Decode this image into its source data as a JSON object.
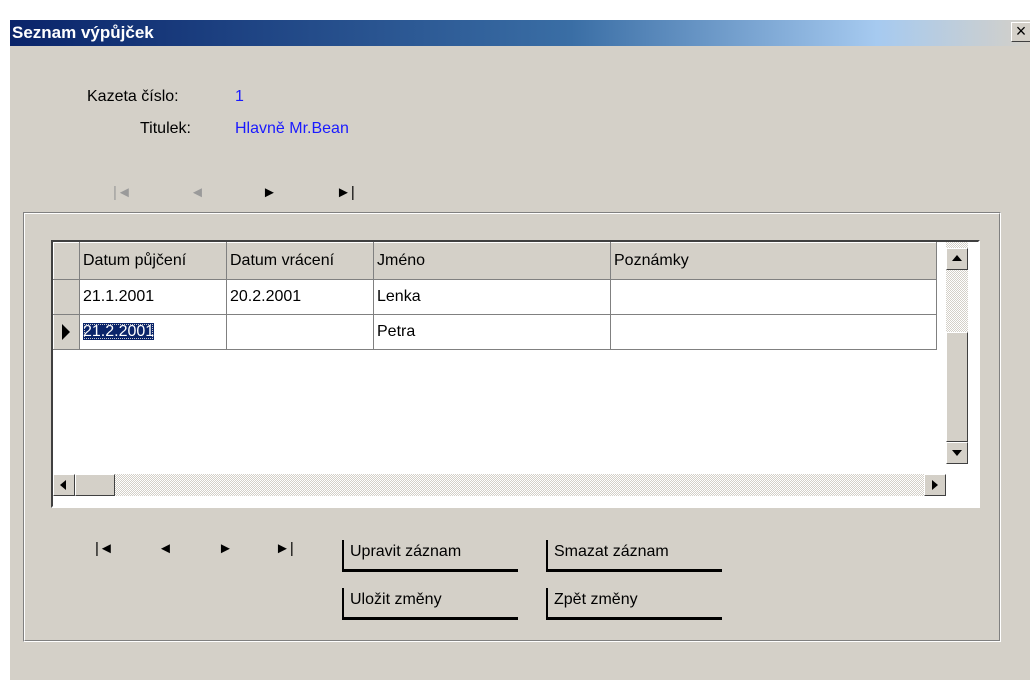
{
  "window": {
    "title": "Seznam výpůjček",
    "close_label": "×"
  },
  "header": {
    "tape_label": "Kazeta číslo:",
    "tape_value": "1",
    "title_label": "Titulek:",
    "title_value": "Hlavně Mr.Bean"
  },
  "top_nav": {
    "first": "|◄",
    "prev": "◄",
    "next": "►",
    "last": "►|"
  },
  "grid": {
    "columns": [
      "Datum půjčení",
      "Datum vrácení",
      "Jméno",
      "Poznámky"
    ],
    "rows": [
      {
        "datum_pujceni": "21.1.2001",
        "datum_vraceni": "20.2.2001",
        "jmeno": "Lenka",
        "poznamky": ""
      },
      {
        "datum_pujceni": "21.2.2001",
        "datum_vraceni": "",
        "jmeno": "Petra",
        "poznamky": ""
      }
    ],
    "selected_row": 2
  },
  "bottom_nav": {
    "first": "|◄",
    "prev": "◄",
    "next": "►",
    "last": "►|"
  },
  "buttons": {
    "edit": "Upravit záznam",
    "delete": "Smazat záznam",
    "save": "Uložit změny",
    "revert": "Zpět změny"
  }
}
